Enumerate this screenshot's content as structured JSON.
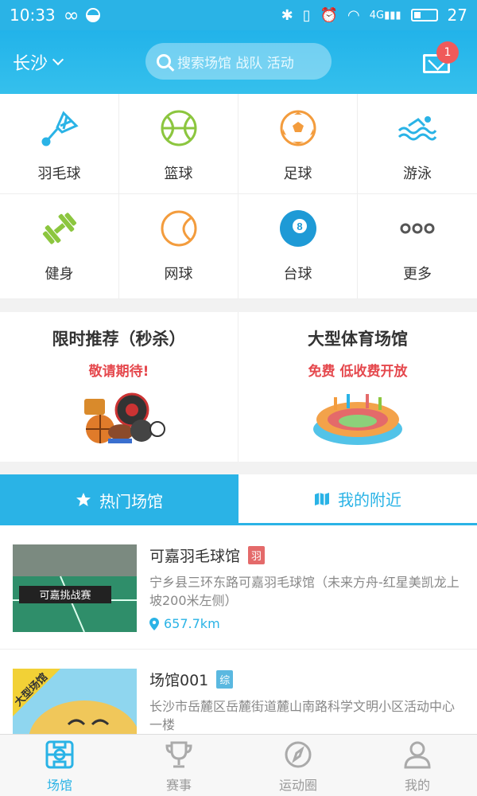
{
  "status_bar": {
    "time": "10:33",
    "battery": "27"
  },
  "header": {
    "city": "长沙",
    "search_placeholder": "搜索场馆 战队 活动",
    "unread_count": "1"
  },
  "categories": [
    {
      "label": "羽毛球",
      "icon": "badminton-icon"
    },
    {
      "label": "篮球",
      "icon": "basketball-icon"
    },
    {
      "label": "足球",
      "icon": "soccer-icon"
    },
    {
      "label": "游泳",
      "icon": "swimming-icon"
    },
    {
      "label": "健身",
      "icon": "fitness-icon"
    },
    {
      "label": "网球",
      "icon": "tennis-icon"
    },
    {
      "label": "台球",
      "icon": "billiards-icon"
    },
    {
      "label": "更多",
      "icon": "more-icon"
    }
  ],
  "promo": {
    "left": {
      "title": "限时推荐（秒杀）",
      "subtitle": "敬请期待!"
    },
    "right": {
      "title": "大型体育场馆",
      "subtitle": "免费  低收费开放"
    }
  },
  "tabs": [
    {
      "label": "热门场馆",
      "icon": "star-icon",
      "active": true
    },
    {
      "label": "我的附近",
      "icon": "map-icon",
      "active": false
    }
  ],
  "venues": [
    {
      "name": "可嘉羽毛球馆",
      "tag": "羽",
      "tag_color": "#e46a6a",
      "address": "宁乡县三环东路可嘉羽毛球馆（未来方舟-红星美凯龙上坡200米左侧）",
      "distance": "657.7km",
      "thumb_text": "可嘉挑战赛"
    },
    {
      "name": "场馆001",
      "tag": "综",
      "tag_color": "#5ab8e0",
      "address": "长沙市岳麓区岳麓街道麓山南路科学文明小区活动中心一楼",
      "ribbon": "大型场馆"
    }
  ],
  "bottom_nav": [
    {
      "label": "场馆",
      "active": true
    },
    {
      "label": "赛事",
      "active": false
    },
    {
      "label": "运动圈",
      "active": false
    },
    {
      "label": "我的",
      "active": false
    }
  ],
  "colors": {
    "primary": "#2ab3e6",
    "accent_red": "#e5484d",
    "badge": "#f05a5a"
  }
}
